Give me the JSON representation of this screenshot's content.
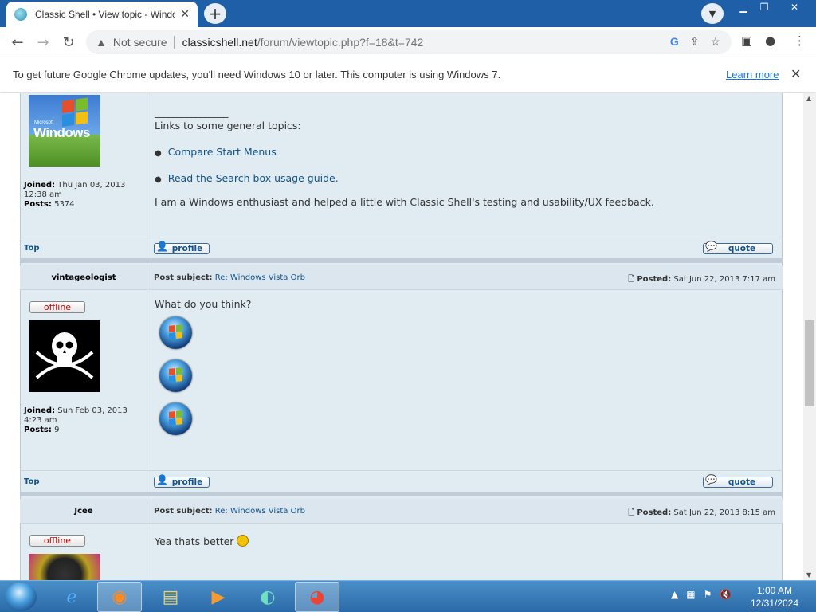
{
  "browser": {
    "tab_title": "Classic Shell • View topic - Windows Vista Orb",
    "tab_close": "✕",
    "new_tab": "+",
    "url_host": "classicshell.net",
    "url_path": "/forum/viewtopic.php?f=18&t=742",
    "security_label": "Not secure"
  },
  "infobar": {
    "message": "To get future Google Chrome updates, you'll need Windows 10 or later. This computer is using Windows 7.",
    "learn_more": "Learn more"
  },
  "post1": {
    "signature_rule": "________________",
    "signature_intro": "Links to some general topics:",
    "links": [
      "Compare Start Menus",
      "Read the Search box usage guide."
    ],
    "signature_text": "I am a Windows enthusiast and helped a little with Classic Shell's testing and usability/UX feedback.",
    "joined_label": "Joined:",
    "joined_value": "Thu Jan 03, 2013",
    "joined_time": "12:38 am",
    "posts_label": "Posts:",
    "posts_value": "5374",
    "avatar_text": "Windows",
    "avatar_small": "Microsoft"
  },
  "post2": {
    "author": "vintageologist",
    "status": "offline",
    "subject_label": "Post subject:",
    "subject": "Re: Windows Vista Orb",
    "posted_label": "Posted:",
    "posted": "Sat Jun 22, 2013 7:17 am",
    "body": "What do you think?",
    "joined_label": "Joined:",
    "joined_value": "Sun Feb 03, 2013",
    "joined_time": "4:23 am",
    "posts_label": "Posts:",
    "posts_value": "9"
  },
  "post3": {
    "author": "Jcee",
    "status": "offline",
    "subject_label": "Post subject:",
    "subject": "Re: Windows Vista Orb",
    "posted_label": "Posted:",
    "posted": "Sat Jun 22, 2013 8:15 am",
    "body": "Yea thats better"
  },
  "actions": {
    "top": "Top",
    "profile": "profile",
    "quote": "quote"
  },
  "taskbar": {
    "time": "1:00 AM",
    "date": "12/31/2024"
  },
  "colors": {
    "post_bg": "#e1ebf2",
    "link": "#105289",
    "offline": "#cc0000",
    "titlebar": "#1f5fa8"
  }
}
